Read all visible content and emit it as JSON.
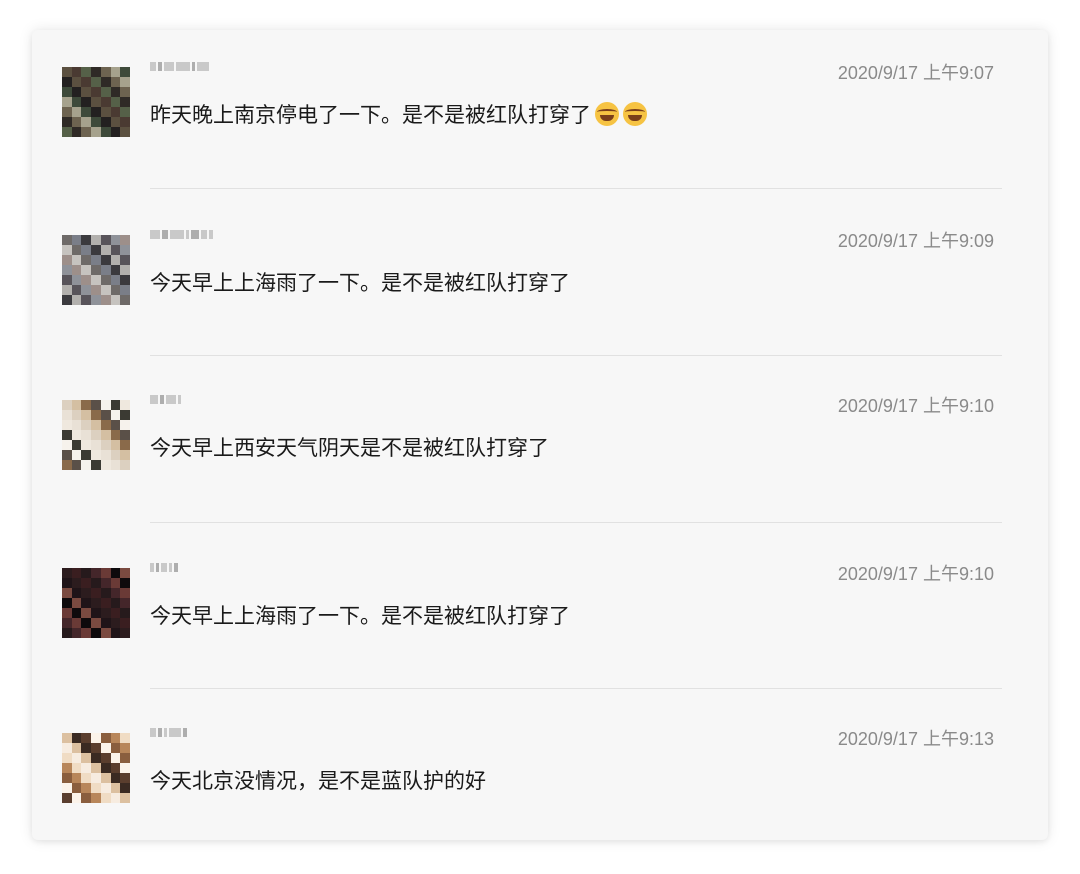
{
  "comments": [
    {
      "time": "2020/9/17 上午9:07",
      "text": "昨天晚上南京停电了一下。是不是被红队打穿了",
      "emojis": [
        "joy-emoji",
        "joy-emoji"
      ],
      "palette": [
        "#5b5040",
        "#2f2a26",
        "#8a7a55",
        "#3e4a3a",
        "#9a8f7a",
        "#4a3a32",
        "#b8a98a",
        "#6d6350",
        "#232020",
        "#c2b89a",
        "#556048",
        "#7b5b45",
        "#a6a28d",
        "#3a3330"
      ]
    },
    {
      "time": "2020/9/17 上午9:09",
      "text": "今天早上上海雨了一下。是不是被红队打穿了",
      "emojis": [],
      "palette": [
        "#5a5e66",
        "#8f9299",
        "#3f4046",
        "#6e6a68",
        "#b2b0ad",
        "#4c4a4f",
        "#9d8f8a",
        "#2e2c30",
        "#7a7e88",
        "#a8a4a2",
        "#58545a",
        "#c6c3bf",
        "#666066",
        "#3b3a3e"
      ]
    },
    {
      "time": "2020/9/17 上午9:10",
      "text": "今天早上西安天气阴天是不是被红队打穿了",
      "emojis": [],
      "palette": [
        "#e9e1d6",
        "#c9a57e",
        "#8a6a4a",
        "#f2ede6",
        "#3b3a33",
        "#b99878",
        "#dcd0c0",
        "#5a5048",
        "#a4825e",
        "#efe8de",
        "#2f3530",
        "#d4bfa2",
        "#7a6652",
        "#f6f2ec"
      ]
    },
    {
      "time": "2020/9/17 上午9:10",
      "text": "今天早上上海雨了一下。是不是被红队打穿了",
      "emojis": [],
      "palette": [
        "#3a1e20",
        "#140d10",
        "#6a3a36",
        "#1f1418",
        "#8a4e44",
        "#261a1c",
        "#5a2e2c",
        "#0e0a0c",
        "#a0685a",
        "#2c1c1e",
        "#44262a",
        "#180f12",
        "#7a4a40",
        "#321e22"
      ]
    },
    {
      "time": "2020/9/17 上午9:13",
      "text": "今天北京没情况，是不是蓝队护的好",
      "emojis": [],
      "palette": [
        "#d9b48a",
        "#f0dcc4",
        "#a67a52",
        "#3a2a22",
        "#e6c8a6",
        "#8a5e3e",
        "#f7ece0",
        "#c49a6e",
        "#5a3e2e",
        "#ead2b6",
        "#b8865a",
        "#2a1e18",
        "#dcc0a0",
        "#fbf3ea"
      ]
    }
  ]
}
